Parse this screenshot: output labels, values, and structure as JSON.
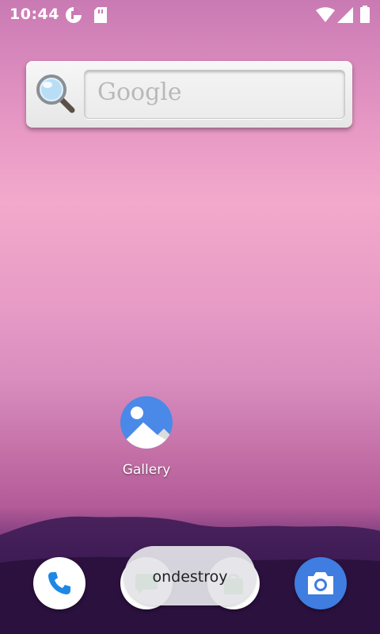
{
  "status_bar": {
    "time": "10:44",
    "icons": [
      "data-saver-icon",
      "sd-card-icon",
      "wifi-icon",
      "cellular-signal-icon",
      "battery-icon"
    ]
  },
  "search_widget": {
    "placeholder": "Google",
    "icon": "magnifier-icon"
  },
  "home_apps": [
    {
      "label": "Gallery",
      "icon": "gallery-icon",
      "accent": "#4a89e8"
    }
  ],
  "dock": {
    "items": [
      {
        "icon": "phone-icon",
        "accent": "#1e88e5"
      },
      {
        "icon": "messaging-icon",
        "accent": "#4caf50"
      },
      {
        "icon": "app-store-icon",
        "accent": "#4caf50"
      },
      {
        "icon": "camera-icon",
        "accent": "#3f7de0"
      }
    ]
  },
  "toast": {
    "text": "ondestroy"
  }
}
